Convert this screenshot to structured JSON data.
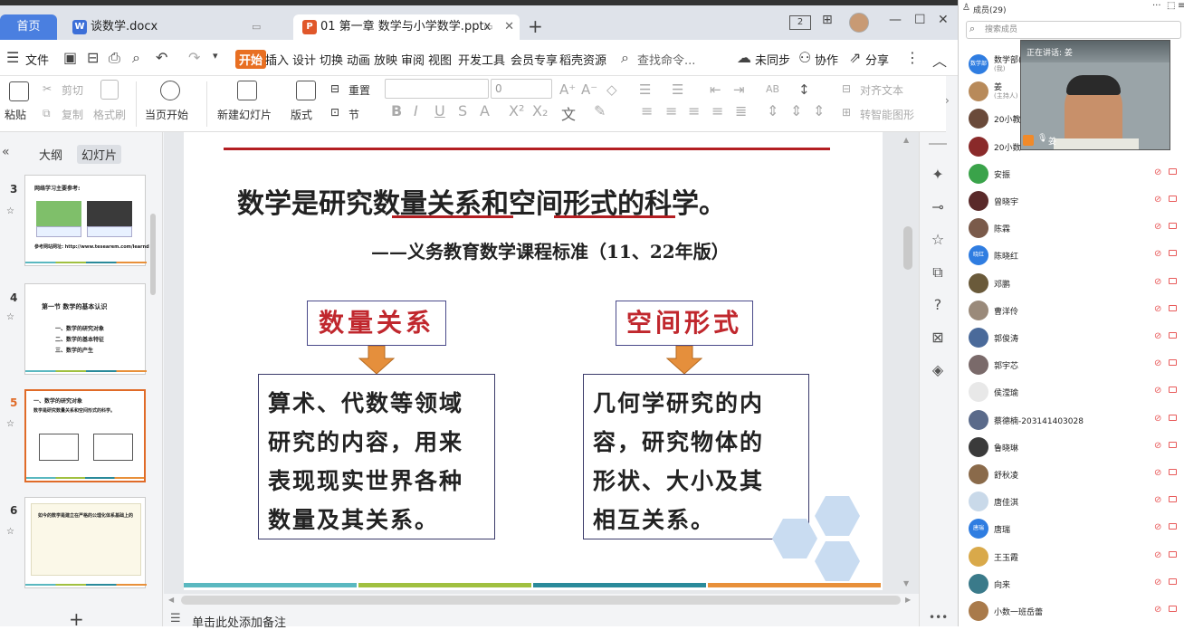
{
  "tabs": {
    "home": "首页",
    "doc": "谈数学.docx",
    "ppt": "01 第一章 数学与小学数学.pptx"
  },
  "titlebar": {
    "view_badge": "2"
  },
  "menu": {
    "file": "文件",
    "start": "开始",
    "insert": "插入",
    "design": "设计",
    "transition": "切换",
    "animation": "动画",
    "slideshow": "放映",
    "review": "审阅",
    "view": "视图",
    "devtools": "开发工具",
    "member": "会员专享",
    "template": "稻壳资源",
    "search": "查找命令...",
    "unsync": "未同步",
    "collab": "协作",
    "share": "分享"
  },
  "ribbon": {
    "paste": "粘贴",
    "cut": "剪切",
    "copy": "复制",
    "format_painter": "格式刷",
    "from_current": "当页开始",
    "new_slide": "新建幻灯片",
    "layout": "版式",
    "reset": "重置",
    "section": "节",
    "font_size": "0",
    "align_text": "对齐文本",
    "smart_shape": "转智能图形"
  },
  "left_pane": {
    "outline_tab": "大纲",
    "slides_tab": "幻灯片",
    "thumbs": [
      {
        "num": "3",
        "title": "网络学习主要参考:",
        "foot": "参考网站网址: http://www.tesearem.com/learnd"
      },
      {
        "num": "4",
        "title": "第一节  数学的基本认识",
        "items": [
          "一、数学的研究对象",
          "二、数学的基本特征",
          "三、数学的产生"
        ]
      },
      {
        "num": "5",
        "title": "一、数学的研究对象",
        "sub": "数学是研究数量关系和空间形式的科学。"
      },
      {
        "num": "6",
        "title": "如今的数学是建立在严格的公理化体系基础上的"
      }
    ]
  },
  "slide": {
    "heading_p1": "数学是研究",
    "heading_u1": "数量关系",
    "heading_p2": "和",
    "heading_u2": "空间形式",
    "heading_p3": "的科学。",
    "citation": "——义务教育数学课程标准（11、22年版）",
    "left_box_title": "数量关系",
    "right_box_title": "空间形式",
    "left_lines": [
      "算术、代数等领域",
      "研究的内容，用来",
      "表现现实世界各种",
      "数量及其关系。"
    ],
    "right_lines": [
      "几何学研究的内",
      "容，研究物体的",
      "形状、大小及其",
      "相互关系。"
    ]
  },
  "notes": {
    "placeholder": "单击此处添加备注"
  },
  "members": {
    "header": "成员(29)",
    "search_placeholder": "搜索成员",
    "speaking": "正在讲话: 姜",
    "video_name": "姜",
    "list": [
      {
        "name": "数学部(",
        "sub": "(我)",
        "color": "#2f7de1",
        "abbr": "数学部"
      },
      {
        "name": "姜",
        "sub": "(主持人)",
        "color": "#b88a5a",
        "abbr": ""
      },
      {
        "name": "20小教7",
        "color": "#6a4a3a",
        "abbr": ""
      },
      {
        "name": "20小数",
        "color": "#8a2a2a",
        "abbr": ""
      },
      {
        "name": "安振",
        "color": "#3aa34a",
        "abbr": ""
      },
      {
        "name": "曾晓宇",
        "color": "#5a2a2a",
        "abbr": ""
      },
      {
        "name": "陈霖",
        "color": "#7a5a4a",
        "abbr": ""
      },
      {
        "name": "陈晓红",
        "color": "#2f7de1",
        "abbr": "晓红"
      },
      {
        "name": "邓鹏",
        "color": "#6a5a3a",
        "abbr": ""
      },
      {
        "name": "曹洋伶",
        "color": "#9a8a7a",
        "abbr": ""
      },
      {
        "name": "郭俊涛",
        "color": "#4a6a9a",
        "abbr": ""
      },
      {
        "name": "郭宇芯",
        "color": "#7a6a6a",
        "abbr": ""
      },
      {
        "name": "侯滢瑜",
        "color": "#e8e8e8",
        "abbr": ""
      },
      {
        "name": "蔡德楠-203141403028",
        "color": "#5a6a8a",
        "abbr": ""
      },
      {
        "name": "鲁晓琳",
        "color": "#3a3a3a",
        "abbr": ""
      },
      {
        "name": "舒秋凌",
        "color": "#8a6a4a",
        "abbr": ""
      },
      {
        "name": "唐佳淇",
        "color": "#c9d9e9",
        "abbr": ""
      },
      {
        "name": "唐瑞",
        "color": "#2f7de1",
        "abbr": "唐瑞"
      },
      {
        "name": "王玉霞",
        "color": "#d9a94a",
        "abbr": ""
      },
      {
        "name": "向来",
        "color": "#3a7a8a",
        "abbr": ""
      },
      {
        "name": "小数一班岳蕾",
        "color": "#a97a4a",
        "abbr": ""
      }
    ]
  }
}
